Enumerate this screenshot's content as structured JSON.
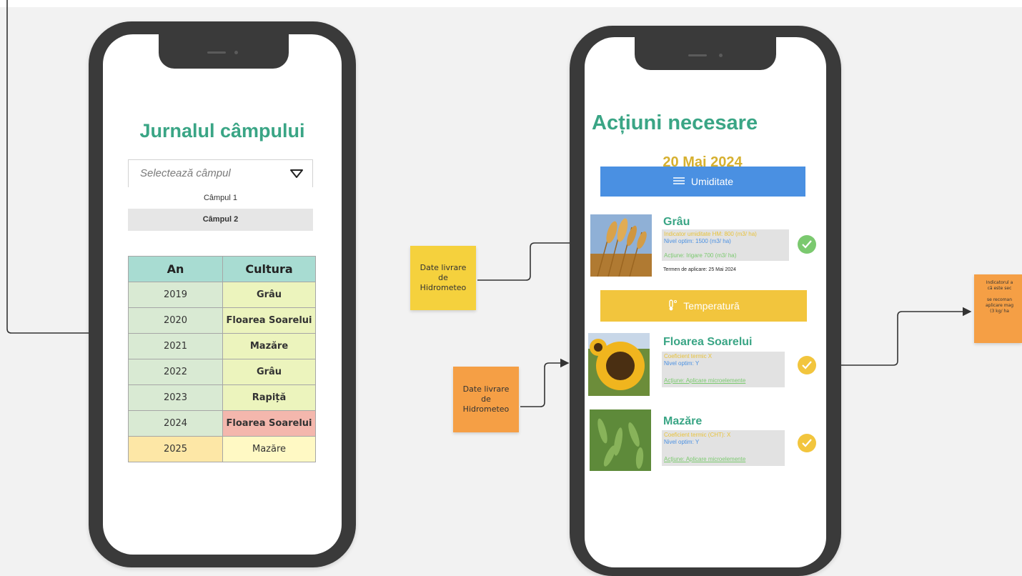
{
  "phone1": {
    "title": "Jurnalul câmpului",
    "select": {
      "placeholder": "Selectează câmpul",
      "options": [
        "Câmpul 1",
        "Câmpul 2"
      ]
    },
    "table": {
      "headers": [
        "An",
        "Cultura"
      ],
      "rows": [
        {
          "year": "2019",
          "crop": "Grâu"
        },
        {
          "year": "2020",
          "crop": "Floarea Soarelui"
        },
        {
          "year": "2021",
          "crop": "Mazăre"
        },
        {
          "year": "2022",
          "crop": "Grâu"
        },
        {
          "year": "2023",
          "crop": "Rapiță"
        },
        {
          "year": "2024",
          "crop": "Floarea Soarelui"
        },
        {
          "year": "2025",
          "crop": "Mazăre"
        }
      ]
    }
  },
  "phone2": {
    "title": "Acțiuni necesare",
    "date": "20 Mai 2024",
    "humidity_button": {
      "label": "Umiditate",
      "icon": "humidity-lines-icon"
    },
    "temperature_button": {
      "label": "Temperatură",
      "icon": "thermometer-icon"
    },
    "crops": [
      {
        "name": "Grâu",
        "image": "wheat-photo",
        "line1": "Indicator umiditate HM: 800 (m3/ ha)",
        "line2": "Nivel optim: 1500 (m3/ ha)",
        "line3": "Acțiune: Irigare 700 (m3/ ha)",
        "term": "Termen de aplicare: 25 Mai 2024",
        "status": "ok"
      },
      {
        "name": "Floarea Soarelui",
        "image": "sunflower-photo",
        "line1": "Coeficient termic X",
        "line2": "Nivel optim: Y",
        "line3": "Acțiune: Aplicare microelemente",
        "status": "warning"
      },
      {
        "name": "Mazăre",
        "image": "peas-photo",
        "line1": "Coeficient termic (CHT): X",
        "line2": "Nivel optim: Y",
        "line3": "Acțiune: Aplicare microelemente",
        "status": "warning"
      }
    ]
  },
  "notes": {
    "note1": {
      "l1": "Date livrare",
      "l2": "de",
      "l3": "Hidrometeo"
    },
    "note2": {
      "l1": "Date livrare",
      "l2": "de",
      "l3": "Hidrometeo"
    },
    "note3": {
      "l1": "Indicatorul a",
      "l2": "că este sec",
      "l3": "se recoman",
      "l4": "aplicare mag",
      "l5": "(3 kg/ ha"
    }
  },
  "colors": {
    "title_green": "#3aa585",
    "date_gold": "#d6b030",
    "humidity_blue": "#4a90e2",
    "temperature_yellow": "#f2c53d",
    "check_green": "#7bc96f",
    "check_yellow": "#f2c53d",
    "note_yellow": "#f5d13d",
    "note_orange": "#f59f45"
  }
}
